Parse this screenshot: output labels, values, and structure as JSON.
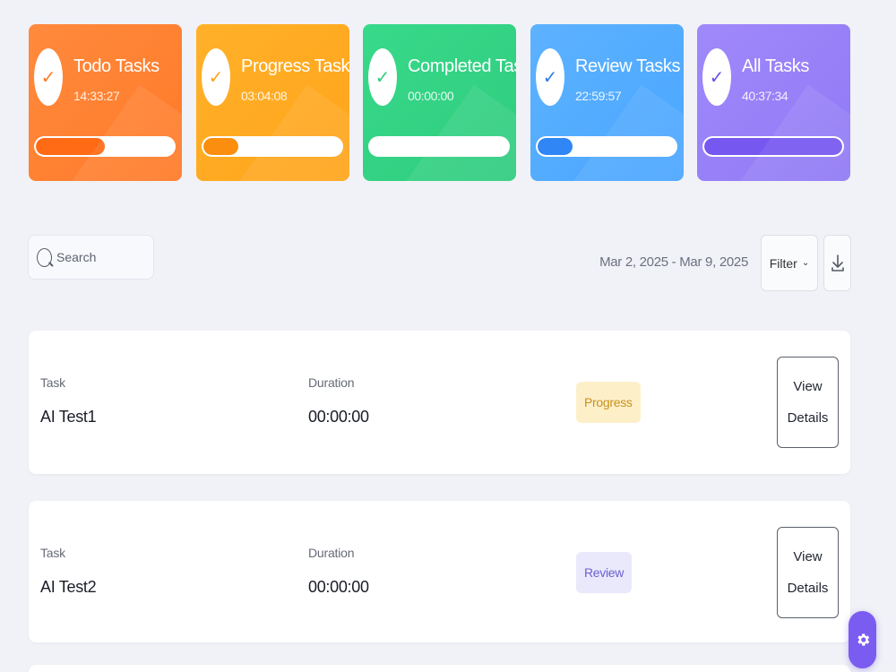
{
  "cards": [
    {
      "key": "todo",
      "title": "Todo Tasks",
      "time": "14:33:27",
      "progress": 0.5,
      "icon": "check-icon"
    },
    {
      "key": "progress",
      "title": "Progress Tasks",
      "time": "03:04:08",
      "progress": 0.25,
      "icon": "check-icon"
    },
    {
      "key": "completed",
      "title": "Completed Tasks",
      "time": "00:00:00",
      "progress": 0.0,
      "icon": "check-icon"
    },
    {
      "key": "review",
      "title": "Review Tasks",
      "time": "22:59:57",
      "progress": 0.25,
      "icon": "check-icon"
    },
    {
      "key": "all",
      "title": "All Tasks",
      "time": "40:37:34",
      "progress": 1.0,
      "icon": "check-icon"
    }
  ],
  "check_glyph": "✓",
  "search": {
    "placeholder": "Search"
  },
  "date_range": "Mar 2, 2025 - Mar 9, 2025",
  "filter": {
    "label": "Filter",
    "chevron": "⌄"
  },
  "tasks": [
    {
      "task_label": "Task",
      "task_name": "AI Test1",
      "duration_label": "Duration",
      "duration": "00:00:00",
      "status": "Progress",
      "status_color": "#c9901c",
      "button": "View Details"
    },
    {
      "task_label": "Task",
      "task_name": "AI Test2",
      "duration_label": "Duration",
      "duration": "00:00:00",
      "status": "Review",
      "status_color": "#6b5fd0",
      "button": "View Details"
    }
  ],
  "colors": {
    "todo": "#ff7a28",
    "progress": "#ffa41b",
    "completed": "#2fcc7e",
    "review": "#4aa6ff",
    "all": "#9079f5",
    "fab": "#7b5cf0"
  }
}
